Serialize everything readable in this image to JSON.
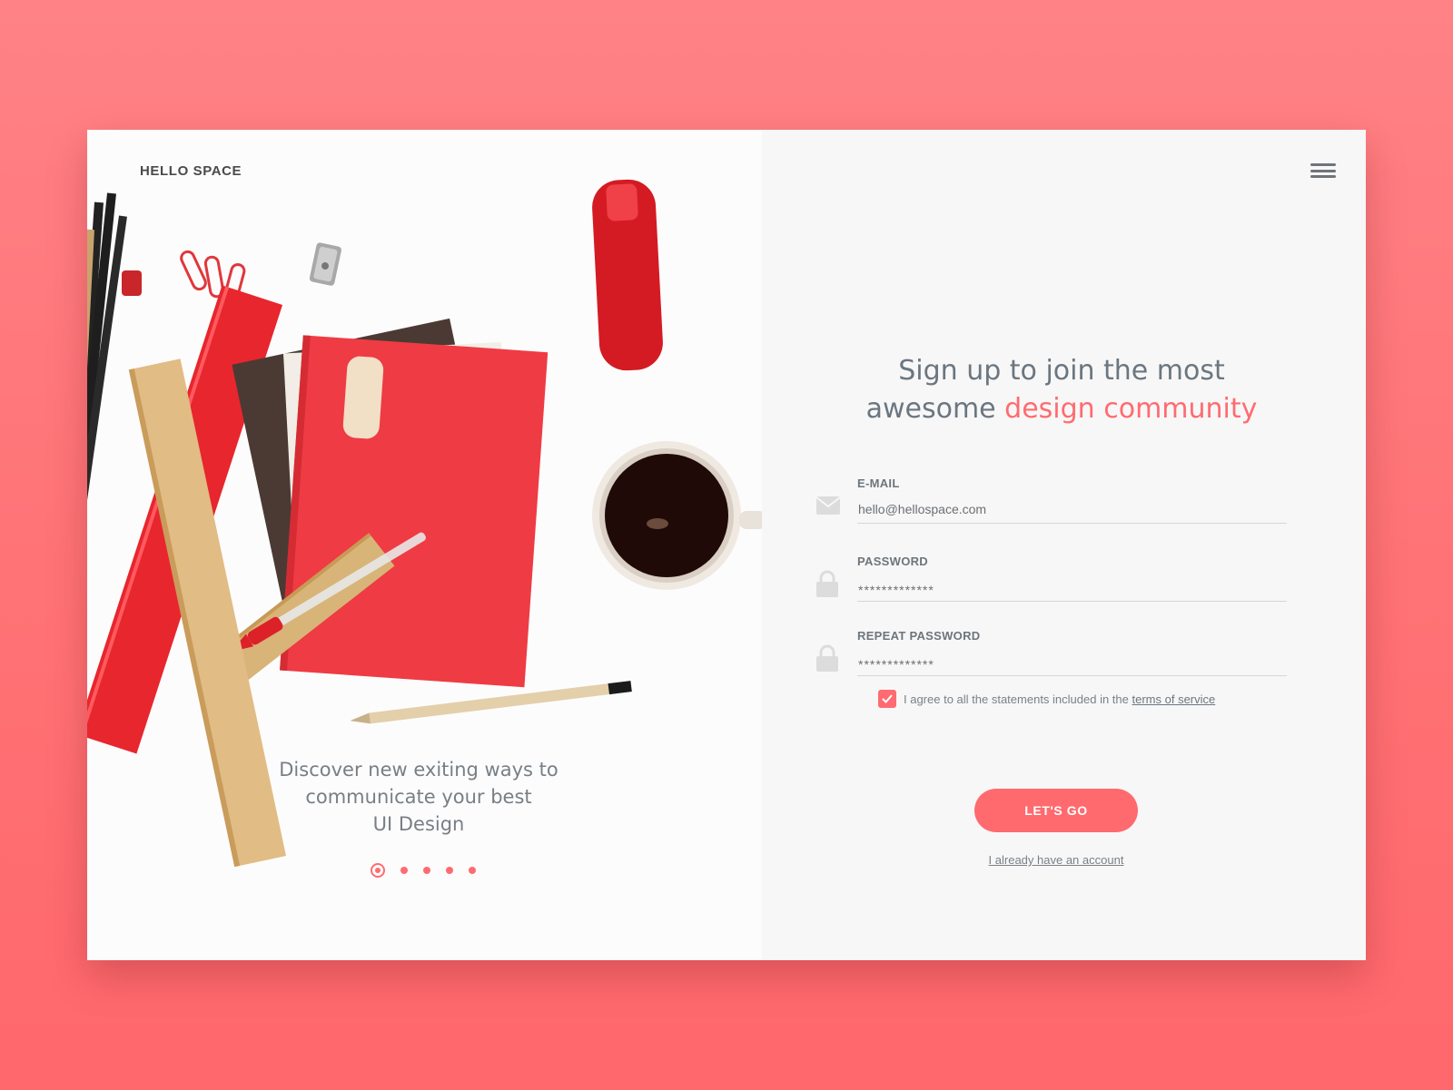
{
  "brand": {
    "name": "HELLO SPACE"
  },
  "hero": {
    "tagline_lines": [
      "Discover new exiting ways to",
      "communicate your best",
      "UI Design"
    ],
    "carousel": {
      "total": 5,
      "active": 1
    }
  },
  "header": {
    "menu_icon": "hamburger-icon"
  },
  "signup": {
    "headline_part1": "Sign up to join the most",
    "headline_part2": "awesome ",
    "headline_accent": "design community",
    "email": {
      "label": "E-MAIL",
      "value": "hello@hellospace.com",
      "icon": "envelope-icon"
    },
    "password": {
      "label": "PASSWORD",
      "value": "*************",
      "icon": "lock-icon"
    },
    "repeat_password": {
      "label": "REPEAT PASSWORD",
      "value": "*************",
      "icon": "lock-icon"
    },
    "agree": {
      "checked": true,
      "text": "I agree to all the statements included in the ",
      "link": "terms of service"
    },
    "submit_label": "LET'S GO",
    "signin_link": "I already have an account"
  },
  "colors": {
    "accent": "#ff6b70",
    "background": "#ff7a7e",
    "panel": "#f7f7f7",
    "text": "#6b7680"
  }
}
